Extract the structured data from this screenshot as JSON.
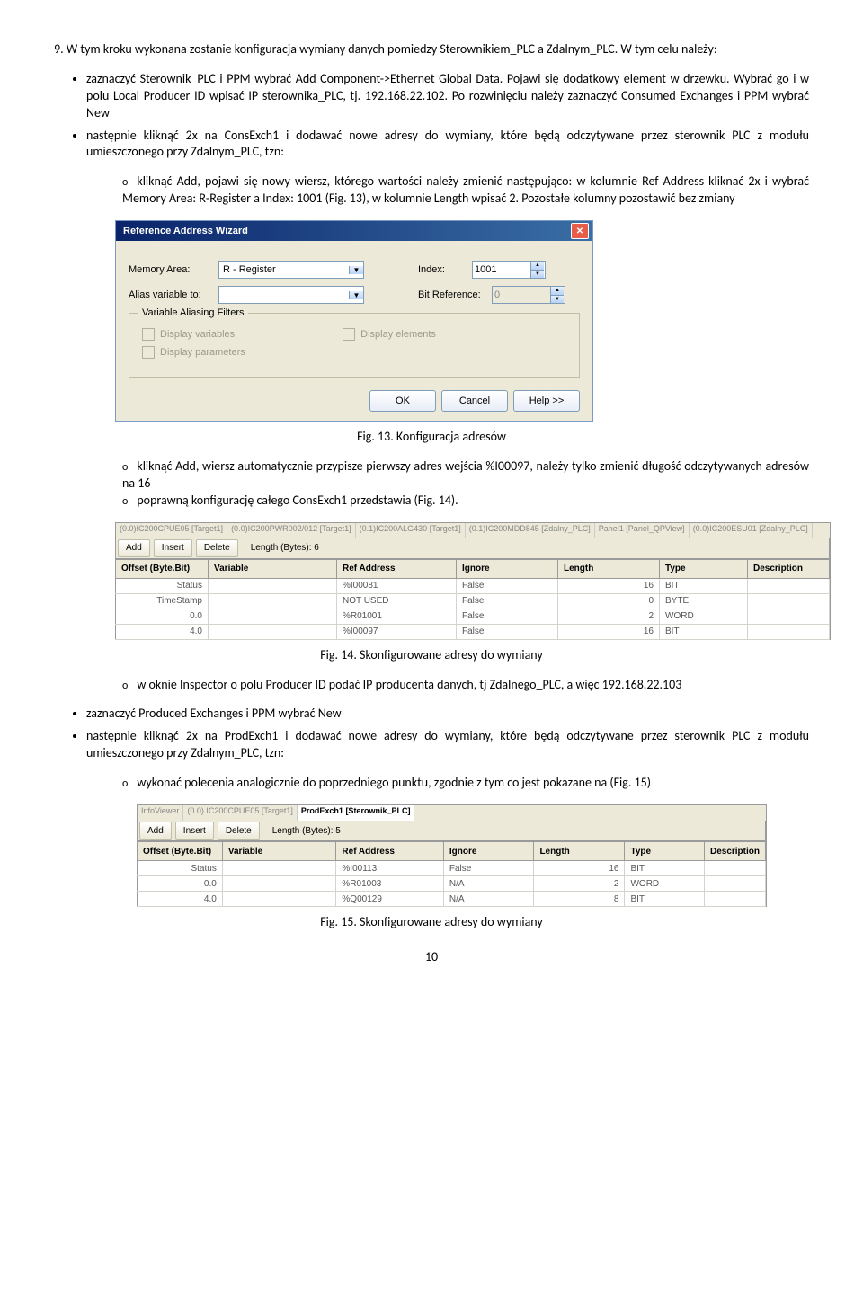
{
  "intro": "9. W tym kroku wykonana zostanie konfiguracja wymiany danych pomiedzy Sterownikiem_PLC a Zdalnym_PLC. W tym celu należy:",
  "bullets": {
    "b1": "zaznaczyć Sterownik_PLC i PPM wybrać Add Component->Ethernet Global Data. Pojawi się dodatkowy element w drzewku. Wybrać go i w polu Local Producer ID wpisać IP sterownika_PLC, tj. 192.168.22.102. Po rozwinięciu należy zaznaczyć Consumed Exchanges i PPM wybrać New",
    "b2": "następnie kliknąć 2x na ConsExch1 i dodawać nowe adresy do wymiany, które będą odczytywane przez sterownik PLC z modułu umieszczonego przy Zdalnym_PLC, tzn:",
    "c1": "kliknąć Add, pojawi się nowy wiersz, którego wartości należy zmienić następująco: w kolumnie Ref Address kliknać 2x i wybrać Memory Area: R-Register a Index: 1001 (Fig. 13), w kolumnie Length wpisać 2. Pozostałe kolumny pozostawić bez zmiany",
    "c2": "kliknąć Add, wiersz automatycznie przypisze pierwszy adres wejścia %I00097, należy tylko zmienić długość odczytywanych adresów na 16",
    "c3": "poprawną konfigurację całego ConsExch1 przedstawia (Fig. 14).",
    "c4": "w oknie Inspector o polu Producer ID podać IP producenta danych, tj Zdalnego_PLC, a więc 192.168.22.103",
    "b3": "zaznaczyć Produced Exchanges i PPM wybrać New",
    "b4": "następnie kliknąć 2x na ProdExch1 i dodawać nowe adresy do wymiany, które będą odczytywane przez sterownik PLC z modułu umieszczonego przy Zdalnym_PLC, tzn:",
    "c5": "wykonać polecenia analogicznie do poprzedniego punktu, zgodnie z tym co jest pokazane na (Fig. 15)"
  },
  "figcaps": {
    "f13": "Fig. 13. Konfiguracja adresów",
    "f14": "Fig. 14. Skonfigurowane adresy do wymiany",
    "f15": "Fig. 15. Skonfigurowane adresy do wymiany"
  },
  "pagenum": "10",
  "wizard": {
    "title": "Reference Address Wizard",
    "memarea_label": "Memory Area:",
    "memarea_value": "R  - Register",
    "index_label": "Index:",
    "index_value": "1001",
    "alias_label": "Alias variable to:",
    "alias_value": "",
    "bitref_label": "Bit Reference:",
    "bitref_value": "0",
    "group_title": "Variable Aliasing Filters",
    "chk_vars": "Display variables",
    "chk_elem": "Display elements",
    "chk_params": "Display parameters",
    "ok": "OK",
    "cancel": "Cancel",
    "help": "Help >>"
  },
  "grid14": {
    "lenlabel": "Length (Bytes): 6",
    "tabs": [
      "(0.0)IC200CPUE05 [Target1]",
      "(0.0)IC200PWR002/012 [Target1]",
      "(0.1)IC200ALG430 [Target1]",
      "(0.1)IC200MDD845 [Zdalny_PLC]",
      "Panel1 [Panel_QPView]",
      "(0.0)IC200ESU01 [Zdalny_PLC]"
    ],
    "toolbar": {
      "add": "Add",
      "insert": "Insert",
      "delete": "Delete"
    },
    "headers": [
      "Offset (Byte.Bit)",
      "Variable",
      "Ref Address",
      "Ignore",
      "Length",
      "Type",
      "Description"
    ],
    "rows": [
      [
        "Status",
        "",
        "%I00081",
        "False",
        "16",
        "BIT",
        ""
      ],
      [
        "TimeStamp",
        "",
        "NOT USED",
        "False",
        "0",
        "BYTE",
        ""
      ],
      [
        "0.0",
        "",
        "%R01001",
        "False",
        "2",
        "WORD",
        ""
      ],
      [
        "4.0",
        "",
        "%I00097",
        "False",
        "16",
        "BIT",
        ""
      ]
    ]
  },
  "grid15": {
    "lenlabel": "Length (Bytes): 5",
    "tabs": [
      "InfoViewer",
      "(0.0) IC200CPUE05 [Target1]",
      "ProdExch1 [Sterownik_PLC]"
    ],
    "toolbar": {
      "add": "Add",
      "insert": "Insert",
      "delete": "Delete"
    },
    "headers": [
      "Offset (Byte.Bit)",
      "Variable",
      "Ref Address",
      "Ignore",
      "Length",
      "Type",
      "Description"
    ],
    "rows": [
      [
        "Status",
        "",
        "%I00113",
        "False",
        "16",
        "BIT",
        ""
      ],
      [
        "0.0",
        "",
        "%R01003",
        "N/A",
        "2",
        "WORD",
        ""
      ],
      [
        "4.0",
        "",
        "%Q00129",
        "N/A",
        "8",
        "BIT",
        ""
      ]
    ]
  }
}
